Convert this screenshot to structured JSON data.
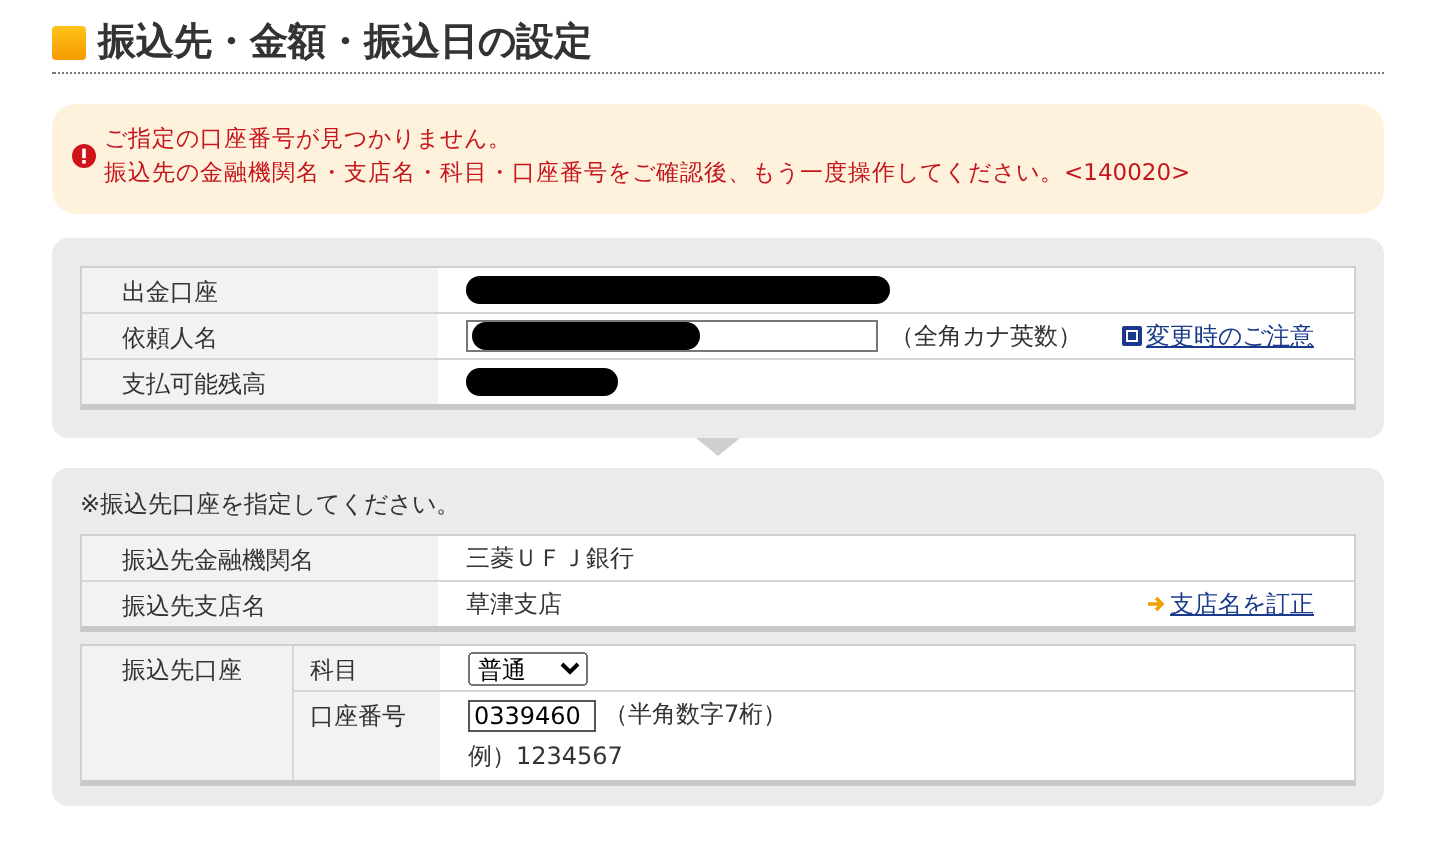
{
  "page_title": "振込先・金額・振込日の設定",
  "error": {
    "lines": [
      "ご指定の口座番号が見つかりません。",
      "振込先の金融機関名・支店名・科目・口座番号をご確認後、もう一度操作してください。<140020>"
    ]
  },
  "source_rows": [
    {
      "label": "出金口座",
      "kind": "redacted-wide"
    },
    {
      "label": "依頼人名",
      "kind": "redacted-input",
      "hint": "（全角カナ英数）",
      "link": "変更時のご注意"
    },
    {
      "label": "支払可能残高",
      "kind": "redacted-narrow"
    }
  ],
  "destination": {
    "note": "※振込先口座を指定してください。",
    "rows": [
      {
        "label": "振込先金融機関名",
        "value": "三菱ＵＦＪ銀行"
      },
      {
        "label": "振込先支店名",
        "value": "草津支店",
        "link": "支店名を訂正"
      }
    ],
    "account": {
      "label": "振込先口座",
      "type_label": "科目",
      "type_value": "普通",
      "number_label": "口座番号",
      "number_value": "0339460",
      "number_hint": "（半角数字7桁）",
      "example": "例）1234567"
    }
  }
}
